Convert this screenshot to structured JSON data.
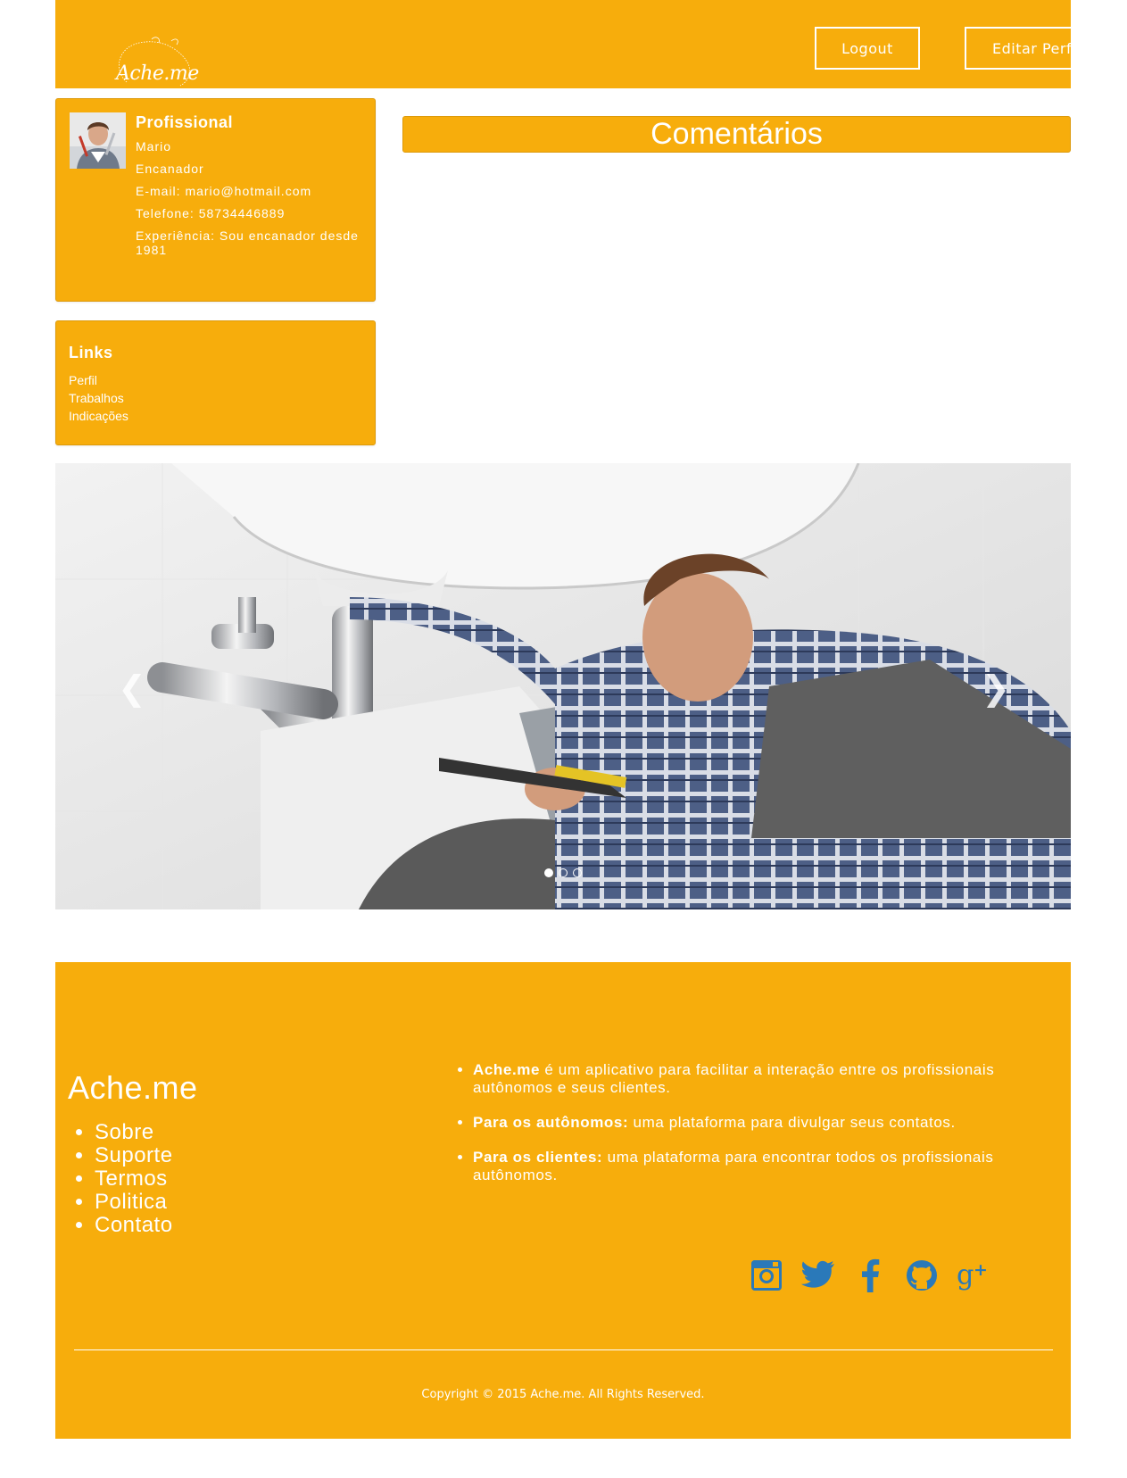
{
  "header": {
    "logo_text": "Ache.me",
    "logout_label": "Logout",
    "edit_profile_label": "Editar Perfil"
  },
  "profile": {
    "title": "Profissional",
    "name": "Mario",
    "occupation": "Encanador",
    "email": "E-mail: mario@hotmail.com",
    "phone": "Telefone: 58734446889",
    "experience": "Experiência: Sou encanador desde 1981"
  },
  "links": {
    "title": "Links",
    "items": [
      {
        "label": "Perfil"
      },
      {
        "label": "Trabalhos"
      },
      {
        "label": "Indicações"
      }
    ]
  },
  "comments": {
    "title": "Comentários"
  },
  "carousel": {
    "prev_icon": "chevron-left-icon",
    "next_icon": "chevron-right-icon",
    "slide_count": 3,
    "active_index": 0
  },
  "footer": {
    "brand": "Ache.me",
    "nav": [
      {
        "label": "Sobre"
      },
      {
        "label": "Suporte"
      },
      {
        "label": "Termos"
      },
      {
        "label": "Politica"
      },
      {
        "label": "Contato"
      }
    ],
    "about": [
      {
        "bold": "Ache.me",
        "text": " é um aplicativo para facilitar a interação entre os profissionais autônomos e seus clientes."
      },
      {
        "bold": "Para os autônomos:",
        "text": " uma plataforma para divulgar seus contatos."
      },
      {
        "bold": "Para os clientes:",
        "text": " uma plataforma para encontrar todos os profissionais autônomos."
      }
    ],
    "social": [
      "instagram-icon",
      "twitter-icon",
      "facebook-icon",
      "github-icon",
      "google-plus-icon"
    ],
    "copyright": "Copyright © 2015 Ache.me. All Rights Reserved."
  },
  "colors": {
    "brand_orange": "#f7ad0c",
    "social_blue": "#2a79b9",
    "text_white": "#ffffff"
  }
}
